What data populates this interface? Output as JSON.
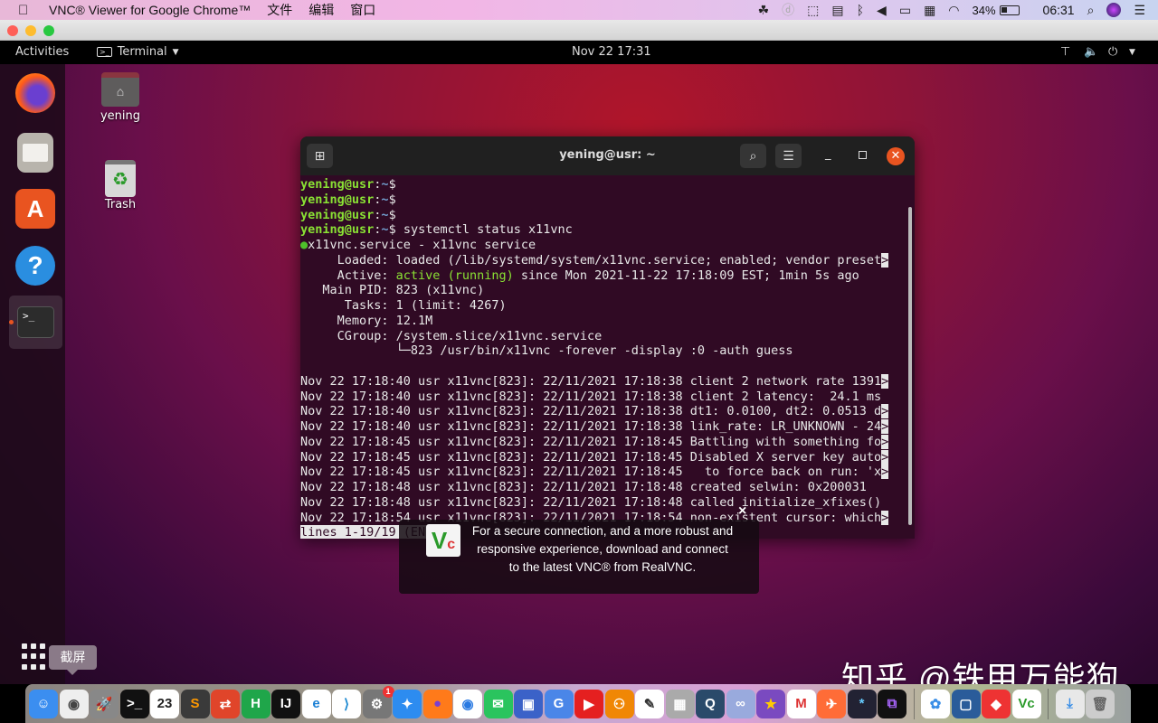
{
  "mac_menubar": {
    "app_name": "VNC® Viewer for Google Chrome™",
    "menus": [
      "文件",
      "编辑",
      "窗口"
    ],
    "battery": "34%",
    "clock": "06:31",
    "status_icons": [
      "creative-cloud-icon",
      "dash-icon",
      "cursor-icon",
      "keyboard-layout-icon",
      "bluetooth-icon",
      "volume-icon",
      "airplay-icon",
      "us-flag-icon",
      "wifi-icon",
      "battery-icon",
      "spotlight-icon",
      "siri-icon",
      "control-center-icon"
    ]
  },
  "vnc_window": {
    "traffic_lights": {
      "close": "#fe5f57",
      "minimize": "#febc2e",
      "zoom": "#28c840"
    }
  },
  "ubuntu_topbar": {
    "activities": "Activities",
    "app_menu": "Terminal",
    "datetime": "Nov 22  17:31"
  },
  "ubuntu_dock": {
    "items": [
      "Firefox",
      "Files",
      "Ubuntu Software",
      "Help",
      "Terminal"
    ],
    "show_apps": "show-applications-icon"
  },
  "desktop_icons": [
    {
      "label": "yening"
    },
    {
      "label": "Trash"
    }
  ],
  "terminal": {
    "title": "yening@usr: ~",
    "lines": [
      [
        {
          "t": "yening@usr",
          "s": "user"
        },
        {
          "t": ":"
        },
        {
          "t": "~",
          "s": "path"
        },
        {
          "t": "$"
        }
      ],
      [
        {
          "t": "yening@usr",
          "s": "user"
        },
        {
          "t": ":"
        },
        {
          "t": "~",
          "s": "path"
        },
        {
          "t": "$"
        }
      ],
      [
        {
          "t": "yening@usr",
          "s": "user"
        },
        {
          "t": ":"
        },
        {
          "t": "~",
          "s": "path"
        },
        {
          "t": "$"
        }
      ],
      [
        {
          "t": "yening@usr",
          "s": "user"
        },
        {
          "t": ":"
        },
        {
          "t": "~",
          "s": "path"
        },
        {
          "t": "$ systemctl status x11vnc"
        }
      ],
      [
        {
          "t": "●",
          "s": "dot"
        },
        {
          "t": "x11vnc.service - x11vnc service"
        }
      ],
      [
        {
          "t": "     Loaded: loaded (/lib/systemd/system/x11vnc.service; enabled; vendor preset"
        },
        {
          "t": ">",
          "s": "inv"
        }
      ],
      [
        {
          "t": "     Active: "
        },
        {
          "t": "active (running)",
          "s": "green"
        },
        {
          "t": " since Mon 2021-11-22 17:18:09 EST; 1min 5s ago"
        }
      ],
      [
        {
          "t": "   Main PID: 823 (x11vnc)"
        }
      ],
      [
        {
          "t": "      Tasks: 1 (limit: 4267)"
        }
      ],
      [
        {
          "t": "     Memory: 12.1M"
        }
      ],
      [
        {
          "t": "     CGroup: /system.slice/x11vnc.service"
        }
      ],
      [
        {
          "t": "             └─823 /usr/bin/x11vnc -forever -display :0 -auth guess"
        }
      ],
      [
        {
          "t": ""
        }
      ],
      [
        {
          "t": "Nov 22 17:18:40 usr x11vnc[823]: 22/11/2021 17:18:38 client 2 network rate 1391"
        },
        {
          "t": ">",
          "s": "inv"
        }
      ],
      [
        {
          "t": "Nov 22 17:18:40 usr x11vnc[823]: 22/11/2021 17:18:38 client 2 latency:  24.1 ms"
        }
      ],
      [
        {
          "t": "Nov 22 17:18:40 usr x11vnc[823]: 22/11/2021 17:18:38 dt1: 0.0100, dt2: 0.0513 d"
        },
        {
          "t": ">",
          "s": "inv"
        }
      ],
      [
        {
          "t": "Nov 22 17:18:40 usr x11vnc[823]: 22/11/2021 17:18:38 link_rate: LR_UNKNOWN - 24"
        },
        {
          "t": ">",
          "s": "inv"
        }
      ],
      [
        {
          "t": "Nov 22 17:18:45 usr x11vnc[823]: 22/11/2021 17:18:45 Battling with something fo"
        },
        {
          "t": ">",
          "s": "inv"
        }
      ],
      [
        {
          "t": "Nov 22 17:18:45 usr x11vnc[823]: 22/11/2021 17:18:45 Disabled X server key auto"
        },
        {
          "t": ">",
          "s": "inv"
        }
      ],
      [
        {
          "t": "Nov 22 17:18:45 usr x11vnc[823]: 22/11/2021 17:18:45   to force back on run: 'x"
        },
        {
          "t": ">",
          "s": "inv"
        }
      ],
      [
        {
          "t": "Nov 22 17:18:48 usr x11vnc[823]: 22/11/2021 17:18:48 created selwin: 0x200031"
        }
      ],
      [
        {
          "t": "Nov 22 17:18:48 usr x11vnc[823]: 22/11/2021 17:18:48 called initialize_xfixes()"
        }
      ],
      [
        {
          "t": "Nov 22 17:18:54 usr x11vnc[823]: 22/11/2021 17:18:54 non-existent cursor: which"
        },
        {
          "t": ">",
          "s": "inv"
        }
      ],
      [
        {
          "t": "lines 1-19/19 (END)",
          "s": "inv"
        }
      ]
    ]
  },
  "vnc_popup": {
    "message": "For a secure connection, and a more robust and responsive experience, download and connect to the latest VNC® from RealVNC.",
    "logo": "VNC",
    "close": "×"
  },
  "tooltip": "截屏",
  "watermark": "知乎 @铁甲万能狗",
  "mac_dock": {
    "items": [
      {
        "name": "finder",
        "bg": "#3b8ef0",
        "g": "☺"
      },
      {
        "name": "screenshot",
        "bg": "#eeeeee",
        "g": "◉",
        "fg": "#444"
      },
      {
        "name": "launchpad",
        "bg": "#888",
        "g": "🚀"
      },
      {
        "name": "terminal",
        "bg": "#111",
        "g": ">_"
      },
      {
        "name": "calendar",
        "bg": "#fff",
        "g": "23",
        "fg": "#222"
      },
      {
        "name": "sublime-text",
        "bg": "#3a3a3a",
        "g": "S",
        "fg": "#f90"
      },
      {
        "name": "remote-desktop",
        "bg": "#e0452a",
        "g": "⇄"
      },
      {
        "name": "hbuilder",
        "bg": "#1fa64a",
        "g": "H"
      },
      {
        "name": "intellij-idea",
        "bg": "#111",
        "g": "IJ"
      },
      {
        "name": "edge",
        "bg": "#fff",
        "g": "e",
        "fg": "#1a7fd4"
      },
      {
        "name": "vscode",
        "bg": "#fff",
        "g": "⟩",
        "fg": "#1f8ad2"
      },
      {
        "name": "system-preferences",
        "bg": "#777",
        "g": "⚙",
        "badge": "1"
      },
      {
        "name": "safari",
        "bg": "#2d8cf0",
        "g": "✦"
      },
      {
        "name": "firefox",
        "bg": "#ff7a1a",
        "g": "●",
        "fg": "#7b3fd0"
      },
      {
        "name": "chrome",
        "bg": "#fff",
        "g": "◉",
        "fg": "#2a7ae2"
      },
      {
        "name": "wechat",
        "bg": "#2ac45e",
        "g": "✉"
      },
      {
        "name": "parallels",
        "bg": "#3b62c8",
        "g": "▣"
      },
      {
        "name": "google-translate",
        "bg": "#4a86e8",
        "g": "G"
      },
      {
        "name": "youtube",
        "bg": "#e52020",
        "g": "▶"
      },
      {
        "name": "drawio",
        "bg": "#f08705",
        "g": "⚇"
      },
      {
        "name": "scroll-reverser",
        "bg": "#fff",
        "g": "✎",
        "fg": "#333"
      },
      {
        "name": "calculator",
        "bg": "#aaa",
        "g": "▦"
      },
      {
        "name": "quicktime",
        "bg": "#2a4a6a",
        "g": "Q"
      },
      {
        "name": "coteditor",
        "bg": "#9ad",
        "g": "∞"
      },
      {
        "name": "superstar",
        "bg": "#7a4ac0",
        "g": "★",
        "fg": "#fc0"
      },
      {
        "name": "gmail",
        "bg": "#fff",
        "g": "M",
        "fg": "#d33"
      },
      {
        "name": "postman",
        "bg": "#ff6c37",
        "g": "✈"
      },
      {
        "name": "jump-desktop",
        "bg": "#223",
        "g": "*",
        "fg": "#6cf"
      },
      {
        "name": "stacks",
        "bg": "#111",
        "g": "⧉",
        "fg": "#a6f"
      },
      {
        "sep": true
      },
      {
        "name": "baidu-netdisk",
        "bg": "#fff",
        "g": "✿",
        "fg": "#3a8ee6"
      },
      {
        "name": "virtualbox",
        "bg": "#2a5c9a",
        "g": "▢"
      },
      {
        "name": "anydesk",
        "bg": "#e33",
        "g": "◆"
      },
      {
        "name": "vnc-viewer",
        "bg": "#fff",
        "g": "Vc",
        "fg": "#2a9a2a"
      },
      {
        "sep": true
      },
      {
        "name": "downloads",
        "bg": "#e8e8e8",
        "g": "⤓",
        "fg": "#3a8ee6"
      },
      {
        "name": "trash",
        "bg": "#ccc",
        "g": "🗑",
        "fg": "#666"
      }
    ]
  }
}
